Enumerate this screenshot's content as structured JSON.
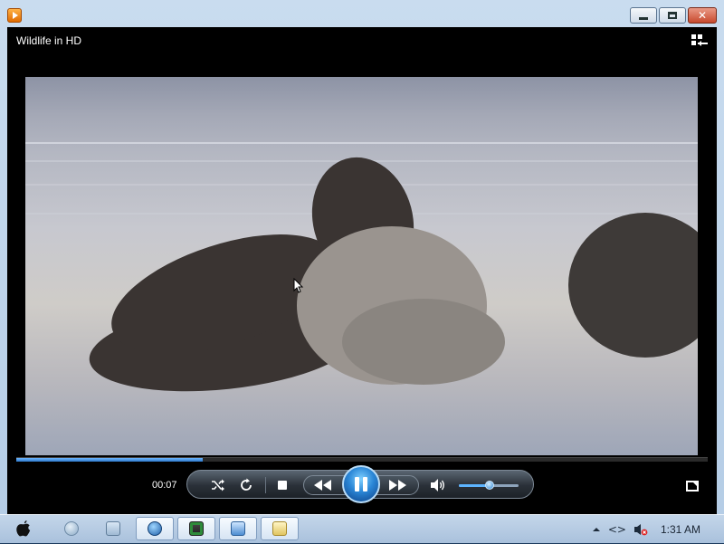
{
  "window": {
    "app_icon": "media-player-icon",
    "caption_buttons": {
      "minimize": "minimize-icon",
      "maximize": "maximize-icon",
      "close_glyph": "✕"
    }
  },
  "player": {
    "video_title": "Wildlife in HD",
    "switch_to_library_icon": "switch-to-library-icon",
    "elapsed_time": "00:07",
    "seek_progress_fraction": 0.27,
    "volume_fraction": 0.52,
    "accent_color": "#2a86d6",
    "controls": {
      "shuffle_icon": "shuffle-icon",
      "repeat_icon": "repeat-icon",
      "stop_icon": "stop-icon",
      "previous_icon": "previous-icon",
      "pause_icon": "pause-icon",
      "next_icon": "next-icon",
      "mute_icon": "speaker-icon",
      "fullscreen_icon": "fullscreen-icon"
    }
  },
  "taskbar": {
    "start_icon": "apple-logo-icon",
    "pinned": [
      {
        "name": "taskbar-app-1",
        "icon": "globe-icon"
      },
      {
        "name": "taskbar-app-2",
        "icon": "folder-icon"
      },
      {
        "name": "taskbar-app-3",
        "icon": "media-player-icon",
        "active": true
      },
      {
        "name": "taskbar-app-4",
        "icon": "monitor-icon"
      },
      {
        "name": "taskbar-app-5",
        "icon": "network-icon"
      },
      {
        "name": "taskbar-app-6",
        "icon": "folder-sync-icon"
      }
    ],
    "tray": {
      "show_hidden_icon": "chevron-up-icon",
      "code_icon_glyph": "<>",
      "volume_muted_icon": "speaker-muted-icon",
      "clock": "1:31 AM"
    }
  }
}
